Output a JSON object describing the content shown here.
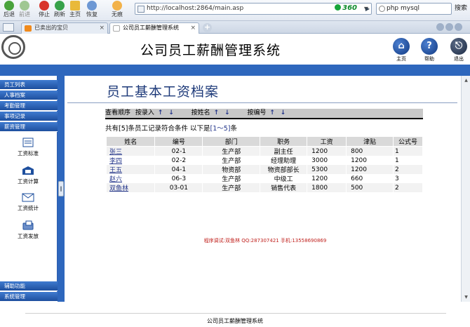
{
  "browser": {
    "toolbar": {
      "back": "后退",
      "forward": "前进",
      "stop": "停止",
      "refresh": "刷新",
      "home": "主页",
      "restore": "恢复",
      "traceless": "无痕"
    },
    "address": "http://localhost:2864/main.asp",
    "security_badge": "360",
    "search_value": "php mysql",
    "search_button": "搜索",
    "tabs": [
      {
        "title": "已卖出的宝贝",
        "favicon_color": "#f08a1c"
      },
      {
        "title": "公司员工薪酬管理系统",
        "favicon_color": "#ffffff"
      }
    ]
  },
  "header": {
    "app_title": "公司员工薪酬管理系统",
    "buttons": [
      {
        "label": "主页",
        "glyph": "⌂",
        "icon": "home-icon"
      },
      {
        "label": "帮助",
        "glyph": "?",
        "icon": "help-icon"
      },
      {
        "label": "退出",
        "glyph": "⎋",
        "icon": "exit-icon"
      }
    ]
  },
  "sidebar": {
    "top_items": [
      "员工列表",
      "人事档案",
      "考勤管理",
      "事项记录",
      "薪资管理"
    ],
    "sub_items": [
      {
        "label": "工资标准",
        "icon": "salary-standard-icon"
      },
      {
        "label": "工资计算",
        "icon": "salary-calc-icon"
      },
      {
        "label": "工资统计",
        "icon": "salary-stats-icon"
      },
      {
        "label": "工资发放",
        "icon": "salary-payout-icon"
      }
    ],
    "bottom_items": [
      "辅助功能",
      "系统管理"
    ]
  },
  "main": {
    "page_title": "员工基本工资档案",
    "sort": {
      "label": "查看顺序",
      "by_entry": "按录入",
      "by_name": "按姓名",
      "by_id": "按编号",
      "up": "↑",
      "down": "↓"
    },
    "summary": {
      "prefix": "共有[5]条员工记录符合条件 以下是",
      "range": "[1～5]",
      "suffix": "条"
    },
    "table": {
      "headers": [
        "姓名",
        "编号",
        "部门",
        "职务",
        "工资",
        "津贴",
        "公式号"
      ],
      "rows": [
        [
          "张三",
          "02-1",
          "生产部",
          "副主任",
          "1200",
          "800",
          "1"
        ],
        [
          "李四",
          "02-2",
          "生产部",
          "经理助理",
          "3000",
          "1200",
          "1"
        ],
        [
          "王五",
          "04-1",
          "物资部",
          "物资部部长",
          "5300",
          "1200",
          "2"
        ],
        [
          "赵六",
          "06-3",
          "生产部",
          "中级工",
          "1200",
          "660",
          "3"
        ],
        [
          "双鱼林",
          "03-01",
          "生产部",
          "销售代表",
          "1800",
          "500",
          "2"
        ]
      ]
    },
    "credits": "程序调试:双鱼林  QQ:287307421  手机:13558690869"
  },
  "footer": {
    "text": "公司员工薪酬管理系统"
  },
  "colors": {
    "brand_blue": "#2e67bd",
    "title_blue": "#1f3b7a",
    "credits_red": "#c0211d"
  }
}
